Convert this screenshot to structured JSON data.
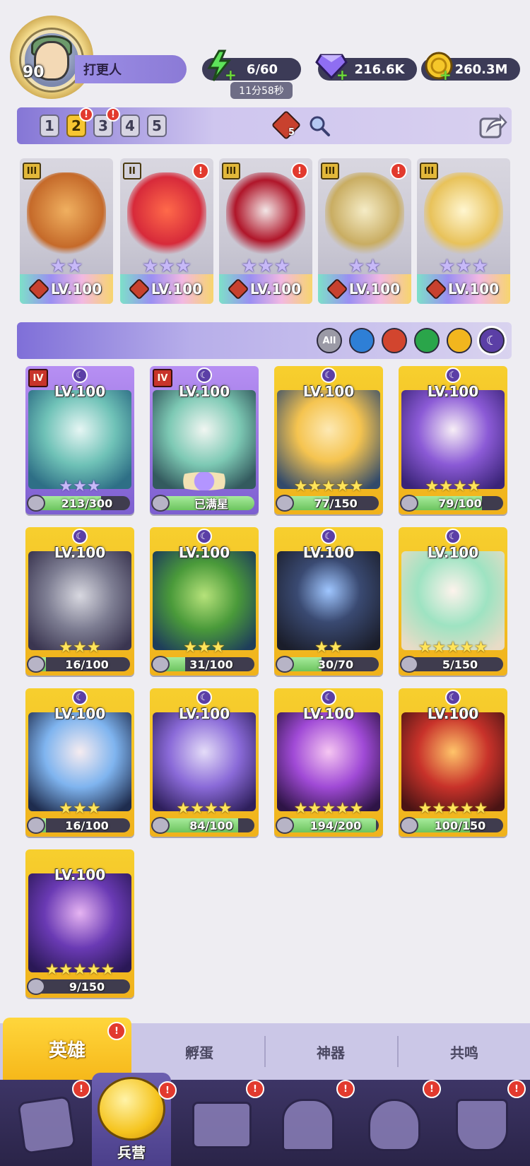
{
  "player": {
    "level": "90",
    "name": "打更人"
  },
  "resources": {
    "energy": "6/60",
    "energy_timer": "11分58秒",
    "gems": "216.6K",
    "gold": "260.3M"
  },
  "team_bar": {
    "teams": [
      "1",
      "2",
      "3",
      "4",
      "5"
    ],
    "active_team": "2",
    "fire_count": "5"
  },
  "team_heroes": [
    {
      "rank": "III",
      "level": "LV.100",
      "stars": "★★",
      "alert": false
    },
    {
      "rank": "II",
      "level": "LV.100",
      "stars": "★★★",
      "alert": true
    },
    {
      "rank": "III",
      "level": "LV.100",
      "stars": "★★★",
      "alert": true
    },
    {
      "rank": "III",
      "level": "LV.100",
      "stars": "★★",
      "alert": true
    },
    {
      "rank": "III",
      "level": "LV.100",
      "stars": "★★★",
      "alert": false
    }
  ],
  "filters": {
    "all_label": "All"
  },
  "heroes": [
    {
      "level": "LV.100",
      "progress": "213/300",
      "fill": 0.71,
      "stars": "★★★",
      "star_color": "purple",
      "rank": "IV",
      "style": "purple"
    },
    {
      "level": "LV.100",
      "progress": "已满星",
      "fill": 1.0,
      "stars": "",
      "star_color": "purple",
      "rank": "IV",
      "style": "purple",
      "maxed": true
    },
    {
      "level": "LV.100",
      "progress": "77/150",
      "fill": 0.51,
      "stars": "★★★★★",
      "star_color": "gold",
      "style": "gold"
    },
    {
      "level": "LV.100",
      "progress": "79/100",
      "fill": 0.79,
      "stars": "★★★★",
      "star_color": "gold",
      "style": "gold"
    },
    {
      "level": "LV.100",
      "progress": "16/100",
      "fill": 0.16,
      "stars": "★★★",
      "star_color": "gold",
      "style": "gold"
    },
    {
      "level": "LV.100",
      "progress": "31/100",
      "fill": 0.31,
      "stars": "★★★",
      "star_color": "gold",
      "style": "gold"
    },
    {
      "level": "LV.100",
      "progress": "30/70",
      "fill": 0.43,
      "stars": "★★",
      "star_color": "gold",
      "style": "gold"
    },
    {
      "level": "LV.100",
      "progress": "5/150",
      "fill": 0.03,
      "stars": "★★★★★",
      "star_color": "gold",
      "style": "gold"
    },
    {
      "level": "LV.100",
      "progress": "16/100",
      "fill": 0.16,
      "stars": "★★★",
      "star_color": "gold",
      "style": "gold"
    },
    {
      "level": "LV.100",
      "progress": "84/100",
      "fill": 0.84,
      "stars": "★★★★",
      "star_color": "gold",
      "style": "gold"
    },
    {
      "level": "LV.100",
      "progress": "194/200",
      "fill": 0.97,
      "stars": "★★★★★",
      "star_color": "gold",
      "style": "gold"
    },
    {
      "level": "LV.100",
      "progress": "100/150",
      "fill": 0.67,
      "stars": "★★★★★",
      "star_color": "gold",
      "style": "gold"
    },
    {
      "level": "LV.100",
      "progress": "9/150",
      "fill": 0.06,
      "stars": "★★★★★",
      "star_color": "gold",
      "style": "gold"
    }
  ],
  "sub_tabs": [
    "英雄",
    "孵蛋",
    "神器",
    "共鸣"
  ],
  "nav": {
    "active_label": "兵营"
  },
  "colors": {
    "accent_purple": "#8b7ad6",
    "accent_gold": "#f6b81a",
    "alert_red": "#e23a2e"
  }
}
